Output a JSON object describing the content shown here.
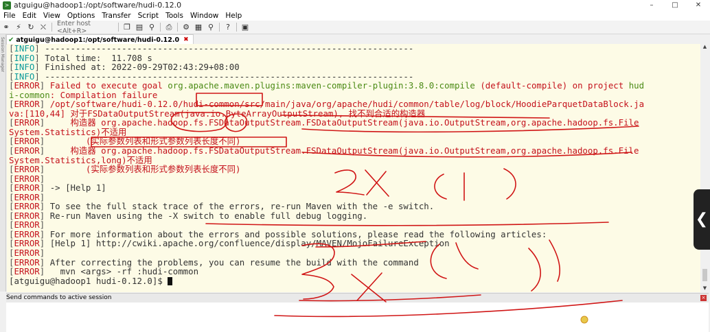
{
  "window": {
    "title": "atguigu@hadoop1:/opt/software/hudi-0.12.0",
    "min": "–",
    "max": "□",
    "close": "✕"
  },
  "menu": [
    "File",
    "Edit",
    "View",
    "Options",
    "Transfer",
    "Script",
    "Tools",
    "Window",
    "Help"
  ],
  "toolbar": {
    "host_placeholder": "Enter host <Alt+R>",
    "icons": [
      "connect-icon",
      "quick-connect-icon",
      "reconnect-icon",
      "disconnect-icon",
      "copy-icon",
      "paste-icon",
      "find-icon",
      "print-icon",
      "settings-icon",
      "key-icon",
      "help-icon",
      "sftp-icon"
    ]
  },
  "tab": {
    "label": "atguigu@hadoop1:/opt/software/hudi-0.12.0",
    "close": "✖"
  },
  "sidebar": {
    "label": "Session Manager"
  },
  "terminal": {
    "lines": [
      {
        "tag": "INFO",
        "text": " ------------------------------------------------------------------------"
      },
      {
        "tag": "INFO",
        "text": " Total time:  11.708 s"
      },
      {
        "tag": "INFO",
        "text": " Finished at: 2022-09-29T02:43:29+08:00"
      },
      {
        "tag": "INFO",
        "text": " ------------------------------------------------------------------------"
      },
      {
        "tag": "ERROR",
        "text": " Failed to execute goal ",
        "green": "org.apache.maven.plugins:maven-compiler-plugin:3.8.0:compile",
        "rest": " (default-compile) on project ",
        "green2": "hud"
      },
      {
        "tag": "",
        "green": "i-common",
        "rest": ": Compilation failure",
        "plain": true
      },
      {
        "tag": "ERROR",
        "text": " /opt/software/hudi-0.12.0/hudi-common/src/main/java/org/apache/hudi/common/table/log/block/HoodieParquetDataBlock.ja"
      },
      {
        "tag": "",
        "text": "va:[110,44] 对于FSDataOutputStream(java.io.ByteArrayOutputStream), 找不到合适的构造器",
        "error": true
      },
      {
        "tag": "ERROR",
        "text": "     构造器 org.apache.hadoop.fs.FSDataOutputStream.FSDataOutputStream(java.io.OutputStream,org.apache.hadoop.fs.File"
      },
      {
        "tag": "",
        "text": "System.Statistics)不适用",
        "error": true
      },
      {
        "tag": "ERROR",
        "text": "        (实际参数列表和形式参数列表长度不同)"
      },
      {
        "tag": "ERROR",
        "text": "     构造器 org.apache.hadoop.fs.FSDataOutputStream.FSDataOutputStream(java.io.OutputStream,org.apache.hadoop.fs.File"
      },
      {
        "tag": "",
        "text": "System.Statistics,long)不适用",
        "error": true
      },
      {
        "tag": "ERROR",
        "text": "        (实际参数列表和形式参数列表长度不同)"
      },
      {
        "tag": "ERROR",
        "text": ""
      },
      {
        "tag": "ERROR",
        "text": " -> [Help 1]",
        "plainbody": true
      },
      {
        "tag": "ERROR",
        "text": ""
      },
      {
        "tag": "ERROR",
        "text": " To see the full stack trace of the errors, re-run Maven with the -e switch.",
        "plainbody": true
      },
      {
        "tag": "ERROR",
        "text": " Re-run Maven using the -X switch to enable full debug logging.",
        "plainbody": true
      },
      {
        "tag": "ERROR",
        "text": ""
      },
      {
        "tag": "ERROR",
        "text": " For more information about the errors and possible solutions, please read the following articles:",
        "plainbody": true
      },
      {
        "tag": "ERROR",
        "text": " [Help 1] http://cwiki.apache.org/confluence/display/MAVEN/MojoFailureException",
        "plainbody": true
      },
      {
        "tag": "ERROR",
        "text": ""
      },
      {
        "tag": "ERROR",
        "text": " After correcting the problems, you can resume the build with the command",
        "plainbody": true
      },
      {
        "tag": "ERROR",
        "text": "   mvn <args> -rf :hudi-common",
        "plainbody": true
      }
    ],
    "prompt": "[atguigu@hadoop1 hudi-0.12.0]$ "
  },
  "sendbar": {
    "label": "Send commands to active session",
    "close": "×"
  },
  "colors": {
    "info": "#0a9a9a",
    "error": "#c4111b",
    "green": "#4a8a14",
    "background": "#fdfbe6",
    "annotation": "#d01515"
  }
}
